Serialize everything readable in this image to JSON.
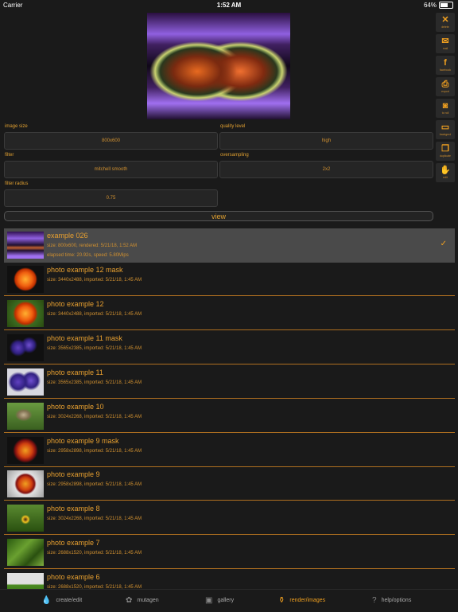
{
  "status": {
    "carrier": "Carrier",
    "time": "1:52 AM",
    "battery": "64%"
  },
  "settings": {
    "image_size_label": "image size",
    "image_size_value": "800x600",
    "quality_label": "quality level",
    "quality_value": "high",
    "filter_label": "filter",
    "filter_value": "mitchell smooth",
    "oversampling_label": "oversampling",
    "oversampling_value": "2x2",
    "filter_radius_label": "filter radius",
    "filter_radius_value": "0.75",
    "view_label": "view"
  },
  "sidebar": [
    {
      "icon": "✕",
      "label": "delete",
      "name": "delete"
    },
    {
      "icon": "✉",
      "label": "mail",
      "name": "mail"
    },
    {
      "icon": "f",
      "label": "facebook",
      "name": "facebook"
    },
    {
      "icon": "⎙",
      "label": "export",
      "name": "export"
    },
    {
      "icon": "◙",
      "label": "to roll",
      "name": "to-roll"
    },
    {
      "icon": "▭",
      "label": "backgrnd",
      "name": "background"
    },
    {
      "icon": "❐",
      "label": "duplicate",
      "name": "duplicate"
    },
    {
      "icon": "✋",
      "label": "edit",
      "name": "edit"
    }
  ],
  "items": [
    {
      "title": "example 026",
      "sub": "size: 800x600, rendered: 5/21/18, 1:52 AM",
      "sub2": "elapsed time: 20.92s, speed: 5.80Mips",
      "selected": true,
      "thumb": "fractal"
    },
    {
      "title": "photo example 12 mask",
      "sub": "size: 3440x2488, imported: 5/21/18, 1:45 AM",
      "thumb": "orange-flower"
    },
    {
      "title": "photo example 12",
      "sub": "size: 3440x2488, imported: 5/21/18, 1:45 AM",
      "thumb": "orange-flower-green"
    },
    {
      "title": "photo example 11 mask",
      "sub": "size: 3565x2385, imported: 5/21/18, 1:45 AM",
      "thumb": "purple-flowers"
    },
    {
      "title": "photo example 11",
      "sub": "size: 3565x2385, imported: 5/21/18, 1:45 AM",
      "thumb": "purple-flowers-white"
    },
    {
      "title": "photo example 10",
      "sub": "size: 3024x2268, imported: 5/21/18, 1:45 AM",
      "thumb": "meerkat"
    },
    {
      "title": "photo example 9 mask",
      "sub": "size: 2958x2898, imported: 5/21/18, 1:45 AM",
      "thumb": "berries"
    },
    {
      "title": "photo example 9",
      "sub": "size: 2958x2898, imported: 5/21/18, 1:45 AM",
      "thumb": "berries-plate"
    },
    {
      "title": "photo example 8",
      "sub": "size: 3024x2268, imported: 5/21/18, 1:45 AM",
      "thumb": "sunflower"
    },
    {
      "title": "photo example 7",
      "sub": "size: 2688x1520, imported: 5/21/18, 1:45 AM",
      "thumb": "leaves"
    },
    {
      "title": "photo example 6",
      "sub": "size: 2688x1520, imported: 5/21/18, 1:45 AM",
      "thumb": "field"
    }
  ],
  "tabs": [
    {
      "label": "create/edit",
      "icon": "💧",
      "name": "create-edit"
    },
    {
      "label": "mutagen",
      "icon": "✿",
      "name": "mutagen"
    },
    {
      "label": "gallery",
      "icon": "▣",
      "name": "gallery"
    },
    {
      "label": "render/images",
      "icon": "⚱",
      "name": "render-images",
      "active": true
    },
    {
      "label": "help/options",
      "icon": "?",
      "name": "help-options"
    }
  ]
}
